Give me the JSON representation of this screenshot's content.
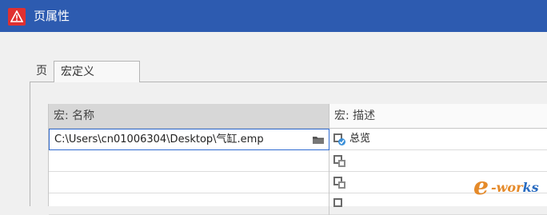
{
  "window": {
    "title": "页属性"
  },
  "tabs": [
    {
      "label": "页"
    },
    {
      "label": "宏定义"
    }
  ],
  "grid": {
    "columns": [
      {
        "label": "宏: 名称"
      },
      {
        "label": "宏: 描述"
      }
    ],
    "rows": [
      {
        "name": "C:\\Users\\cn01006304\\Desktop\\气缸.emp",
        "desc": "总览"
      },
      {
        "name": "",
        "desc": ""
      },
      {
        "name": "",
        "desc": ""
      },
      {
        "name": "",
        "desc": ""
      }
    ]
  },
  "watermark": {
    "prefix": "e",
    "middle": "-wor",
    "suffix": "ks"
  },
  "colors": {
    "titlebar": "#2d5bb0",
    "accent": "#e03030"
  }
}
